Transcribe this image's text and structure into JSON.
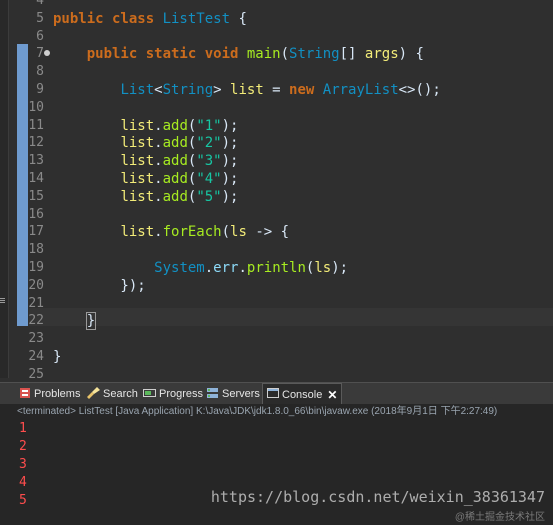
{
  "editor": {
    "lines": [
      {
        "num": "4",
        "tokens": []
      },
      {
        "num": "5",
        "tokens": [
          {
            "t": "public class ",
            "c": "kw"
          },
          {
            "t": "ListTest",
            "c": "cls"
          },
          {
            "t": " {",
            "c": "plain"
          }
        ]
      },
      {
        "num": "6",
        "tokens": []
      },
      {
        "num": "7",
        "tokens": [
          {
            "t": "    public static void ",
            "c": "kw"
          },
          {
            "t": "main",
            "c": "mth"
          },
          {
            "t": "(",
            "c": "plain"
          },
          {
            "t": "String",
            "c": "cls"
          },
          {
            "t": "[] ",
            "c": "plain"
          },
          {
            "t": "args",
            "c": "var"
          },
          {
            "t": ") {",
            "c": "plain"
          }
        ]
      },
      {
        "num": "8",
        "tokens": []
      },
      {
        "num": "9",
        "tokens": [
          {
            "t": "        ",
            "c": "plain"
          },
          {
            "t": "List",
            "c": "cls"
          },
          {
            "t": "<",
            "c": "plain"
          },
          {
            "t": "String",
            "c": "cls"
          },
          {
            "t": "> ",
            "c": "plain"
          },
          {
            "t": "list",
            "c": "var"
          },
          {
            "t": " = ",
            "c": "plain"
          },
          {
            "t": "new ",
            "c": "kw"
          },
          {
            "t": "ArrayList",
            "c": "cls"
          },
          {
            "t": "<>();",
            "c": "plain"
          }
        ]
      },
      {
        "num": "10",
        "tokens": []
      },
      {
        "num": "11",
        "tokens": [
          {
            "t": "        ",
            "c": "plain"
          },
          {
            "t": "list",
            "c": "var"
          },
          {
            "t": ".",
            "c": "plain"
          },
          {
            "t": "add",
            "c": "mth"
          },
          {
            "t": "(",
            "c": "plain"
          },
          {
            "t": "\"1\"",
            "c": "str"
          },
          {
            "t": ");",
            "c": "plain"
          }
        ]
      },
      {
        "num": "12",
        "tokens": [
          {
            "t": "        ",
            "c": "plain"
          },
          {
            "t": "list",
            "c": "var"
          },
          {
            "t": ".",
            "c": "plain"
          },
          {
            "t": "add",
            "c": "mth"
          },
          {
            "t": "(",
            "c": "plain"
          },
          {
            "t": "\"2\"",
            "c": "str"
          },
          {
            "t": ");",
            "c": "plain"
          }
        ]
      },
      {
        "num": "13",
        "tokens": [
          {
            "t": "        ",
            "c": "plain"
          },
          {
            "t": "list",
            "c": "var"
          },
          {
            "t": ".",
            "c": "plain"
          },
          {
            "t": "add",
            "c": "mth"
          },
          {
            "t": "(",
            "c": "plain"
          },
          {
            "t": "\"3\"",
            "c": "str"
          },
          {
            "t": ");",
            "c": "plain"
          }
        ]
      },
      {
        "num": "14",
        "tokens": [
          {
            "t": "        ",
            "c": "plain"
          },
          {
            "t": "list",
            "c": "var"
          },
          {
            "t": ".",
            "c": "plain"
          },
          {
            "t": "add",
            "c": "mth"
          },
          {
            "t": "(",
            "c": "plain"
          },
          {
            "t": "\"4\"",
            "c": "str"
          },
          {
            "t": ");",
            "c": "plain"
          }
        ]
      },
      {
        "num": "15",
        "tokens": [
          {
            "t": "        ",
            "c": "plain"
          },
          {
            "t": "list",
            "c": "var"
          },
          {
            "t": ".",
            "c": "plain"
          },
          {
            "t": "add",
            "c": "mth"
          },
          {
            "t": "(",
            "c": "plain"
          },
          {
            "t": "\"5\"",
            "c": "str"
          },
          {
            "t": ");",
            "c": "plain"
          }
        ]
      },
      {
        "num": "16",
        "tokens": []
      },
      {
        "num": "17",
        "tokens": [
          {
            "t": "        ",
            "c": "plain"
          },
          {
            "t": "list",
            "c": "var"
          },
          {
            "t": ".",
            "c": "plain"
          },
          {
            "t": "forEach",
            "c": "mth"
          },
          {
            "t": "(",
            "c": "plain"
          },
          {
            "t": "ls",
            "c": "var"
          },
          {
            "t": " -> {",
            "c": "plain"
          }
        ]
      },
      {
        "num": "18",
        "tokens": []
      },
      {
        "num": "19",
        "tokens": [
          {
            "t": "            ",
            "c": "plain"
          },
          {
            "t": "System",
            "c": "cls"
          },
          {
            "t": ".",
            "c": "plain"
          },
          {
            "t": "err",
            "c": "field"
          },
          {
            "t": ".",
            "c": "plain"
          },
          {
            "t": "println",
            "c": "mth"
          },
          {
            "t": "(",
            "c": "plain"
          },
          {
            "t": "ls",
            "c": "var"
          },
          {
            "t": ");",
            "c": "plain"
          }
        ]
      },
      {
        "num": "20",
        "tokens": [
          {
            "t": "        });",
            "c": "plain"
          }
        ]
      },
      {
        "num": "21",
        "tokens": []
      },
      {
        "num": "22",
        "tokens": [
          {
            "t": "    ",
            "c": "plain"
          },
          {
            "t": "}",
            "c": "plain",
            "bracket": true
          },
          {
            "t": "",
            "c": "caret"
          }
        ]
      },
      {
        "num": "23",
        "tokens": []
      },
      {
        "num": "24",
        "tokens": [
          {
            "t": "}",
            "c": "plain"
          }
        ]
      },
      {
        "num": "25",
        "tokens": []
      }
    ]
  },
  "panel": {
    "tabs": {
      "problems": "Problems",
      "search": "Search",
      "progress": "Progress",
      "servers": "Servers",
      "console": "Console"
    },
    "close_label": "✕",
    "status": "<terminated> ListTest [Java Application] K:\\Java\\JDK\\jdk1.8.0_66\\bin\\javaw.exe (2018年9月1日 下午2:27:49)",
    "output": [
      "1",
      "2",
      "3",
      "4",
      "5"
    ]
  },
  "watermark": {
    "url": "https://blog.csdn.net/weixin_38361347",
    "brand": "@稀土掘金技术社区"
  }
}
